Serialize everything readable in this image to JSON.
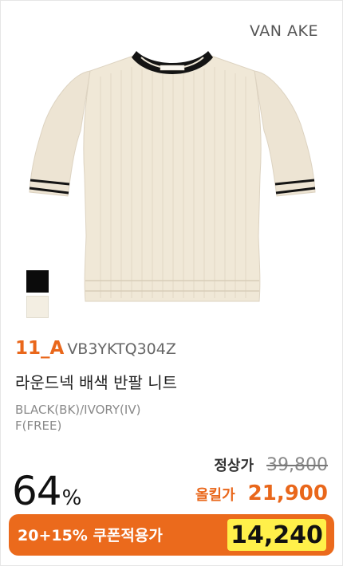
{
  "brand": "VAN AKE",
  "product": {
    "image_alt": "knit-short-sleeve-top",
    "model_label": "11_A",
    "sku": "VB3YKTQ304Z",
    "name": "라운드넥 배색 반팔 니트",
    "color_text": "BLACK(BK)/IVORY(IV)",
    "size_text": "F(FREE)",
    "swatches": [
      "#0b0b0b",
      "#f3eee2"
    ]
  },
  "pricing": {
    "discount_number": "64",
    "discount_unit": "%",
    "regular_label": "정상가",
    "regular_price": "39,800",
    "sale_label": "올킬가",
    "sale_price": "21,900",
    "coupon_label": "20+15% 쿠폰적용가",
    "coupon_price": "14,240"
  },
  "colors": {
    "accent": "#eb6a1c",
    "highlight": "#fff04a"
  }
}
